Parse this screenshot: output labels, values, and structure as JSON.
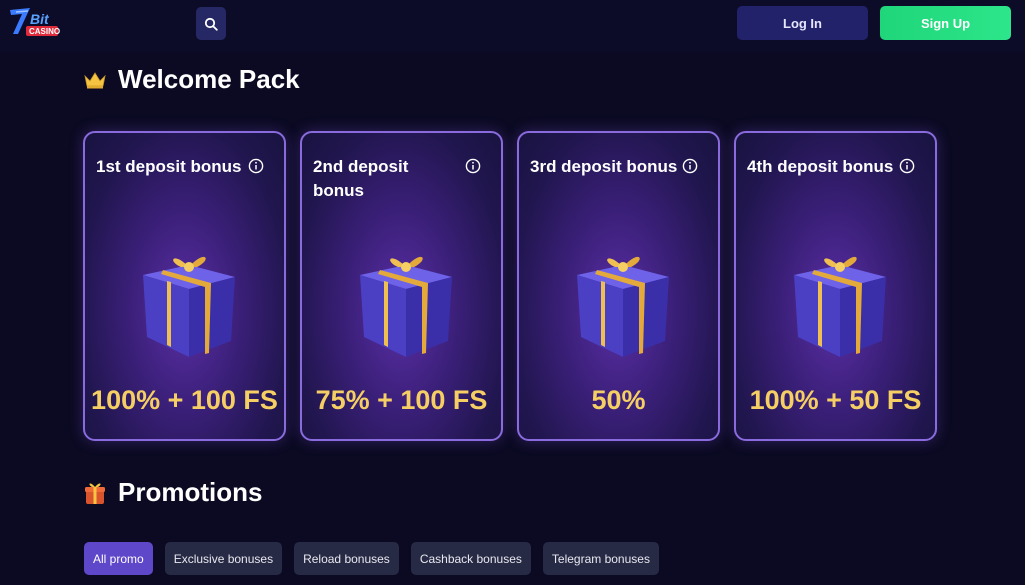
{
  "header": {
    "logo_text": "7Bit Casino",
    "login_label": "Log In",
    "signup_label": "Sign Up"
  },
  "welcome": {
    "title": "Welcome Pack",
    "cards": [
      {
        "title": "1st deposit bonus",
        "value": "100% + 100 FS"
      },
      {
        "title": "2nd deposit bonus",
        "value": "75% + 100 FS"
      },
      {
        "title": "3rd deposit bonus",
        "value": "50%"
      },
      {
        "title": "4th deposit bonus",
        "value": "100% + 50 FS"
      }
    ]
  },
  "promotions": {
    "title": "Promotions",
    "tabs": [
      {
        "label": "All promo",
        "active": true
      },
      {
        "label": "Exclusive bonuses",
        "active": false
      },
      {
        "label": "Reload bonuses",
        "active": false
      },
      {
        "label": "Cashback bonuses",
        "active": false
      },
      {
        "label": "Telegram bonuses",
        "active": false
      }
    ]
  },
  "colors": {
    "background": "#0b0a22",
    "accent_gold": "#f5cf63",
    "signup_green": "#2de58a",
    "login_navy": "#22226a",
    "card_border": "#8a6bdd",
    "tab_active": "#5e47c9"
  },
  "icons": {
    "search": "search-icon",
    "crown": "crown-icon",
    "gift_section": "gift-icon",
    "info": "info-icon"
  }
}
